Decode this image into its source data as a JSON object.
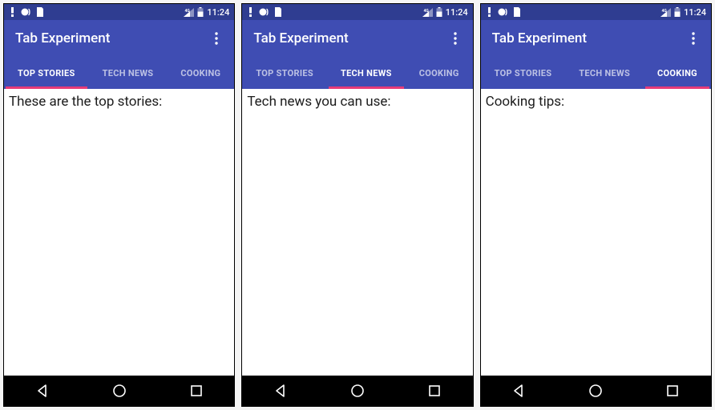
{
  "status": {
    "time": "11:24"
  },
  "appbar": {
    "title": "Tab Experiment"
  },
  "tabs": [
    {
      "label": "TOP STORIES"
    },
    {
      "label": "TECH NEWS"
    },
    {
      "label": "COOKING"
    }
  ],
  "screens": [
    {
      "activeTab": 0,
      "content": "These are the top stories:"
    },
    {
      "activeTab": 1,
      "content": "Tech news you can use:"
    },
    {
      "activeTab": 2,
      "content": "Cooking tips:"
    }
  ]
}
